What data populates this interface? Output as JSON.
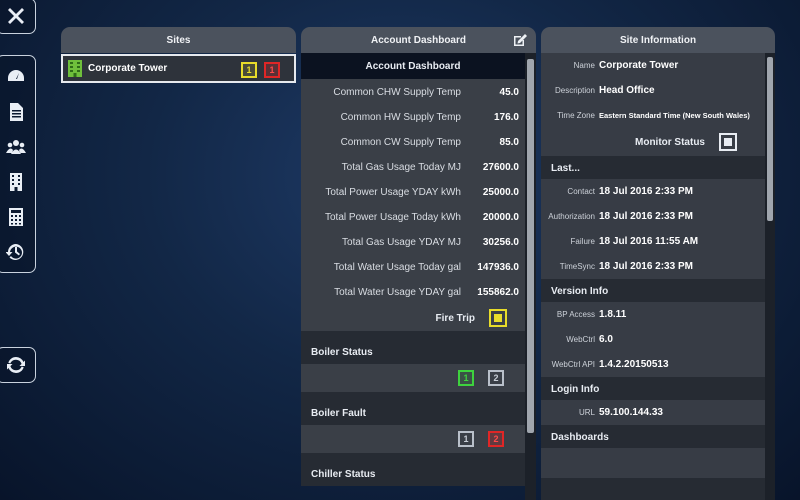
{
  "rail": {
    "close_icon": "close-icon",
    "nav_icons": [
      "dashboard-icon",
      "document-icon",
      "users-icon",
      "building-icon",
      "calculator-icon",
      "history-icon"
    ],
    "refresh_icon": "refresh-icon"
  },
  "sites": {
    "title": "Sites",
    "items": [
      {
        "name": "Corporate Tower",
        "badges": [
          {
            "label": "1",
            "color": "yellow"
          },
          {
            "label": "1",
            "color": "red"
          }
        ]
      }
    ]
  },
  "account": {
    "title": "Account Dashboard",
    "sub_title": "Account Dashboard",
    "metrics": [
      {
        "label": "Common CHW Supply Temp",
        "value": "45.0"
      },
      {
        "label": "Common HW Supply Temp",
        "value": "176.0"
      },
      {
        "label": "Common CW Supply Temp",
        "value": "85.0"
      },
      {
        "label": "Total Gas Usage Today MJ",
        "value": "27600.0"
      },
      {
        "label": "Total Power Usage YDAY kWh",
        "value": "25000.0"
      },
      {
        "label": "Total Power Usage Today kWh",
        "value": "20000.0"
      },
      {
        "label": "Total Gas Usage YDAY MJ",
        "value": "30256.0"
      },
      {
        "label": "Total Water Usage Today gal",
        "value": "147936.0"
      },
      {
        "label": "Total Water Usage YDAY gal",
        "value": "155862.0"
      }
    ],
    "fire_trip": {
      "label": "Fire Trip",
      "color": "#e8dc2a"
    },
    "boiler_status": {
      "title": "Boiler  Status",
      "badges": [
        {
          "label": "1",
          "color": "green"
        },
        {
          "label": "2",
          "color": "grey"
        }
      ]
    },
    "boiler_fault": {
      "title": "Boiler  Fault",
      "badges": [
        {
          "label": "1",
          "color": "grey"
        },
        {
          "label": "2",
          "color": "red"
        }
      ]
    },
    "chiller_status": {
      "title": "Chiller  Status"
    }
  },
  "info": {
    "title": "Site Information",
    "name_label": "Name",
    "name_value": "Corporate Tower",
    "description_label": "Description",
    "description_value": "Head Office",
    "timezone_label": "Time Zone",
    "timezone_value": "Eastern Standard Time (New South Wales)",
    "monitor_status": "Monitor Status",
    "last_title": "Last...",
    "last": [
      {
        "label": "Contact",
        "value": "18 Jul 2016 2:33 PM"
      },
      {
        "label": "Authorization",
        "value": "18 Jul 2016 2:33 PM"
      },
      {
        "label": "Failure",
        "value": "18 Jul 2016 11:55 AM"
      },
      {
        "label": "TimeSync",
        "value": "18 Jul 2016 2:33 PM"
      }
    ],
    "version_title": "Version Info",
    "version": [
      {
        "label": "BP Access",
        "value": "1.8.11"
      },
      {
        "label": "WebCtrl",
        "value": "6.0"
      },
      {
        "label": "WebCtrl API",
        "value": "1.4.2.20150513"
      }
    ],
    "login_title": "Login Info",
    "login": [
      {
        "label": "URL",
        "value": "59.100.144.33"
      }
    ],
    "dashboards_title": "Dashboards"
  },
  "colors": {
    "yellow": "#e8dc2a",
    "red": "#e02626",
    "green": "#3ed23e",
    "grey": "#b9c0ca",
    "panel_header": "#4b525d",
    "panel_body": "#2a2f38"
  }
}
